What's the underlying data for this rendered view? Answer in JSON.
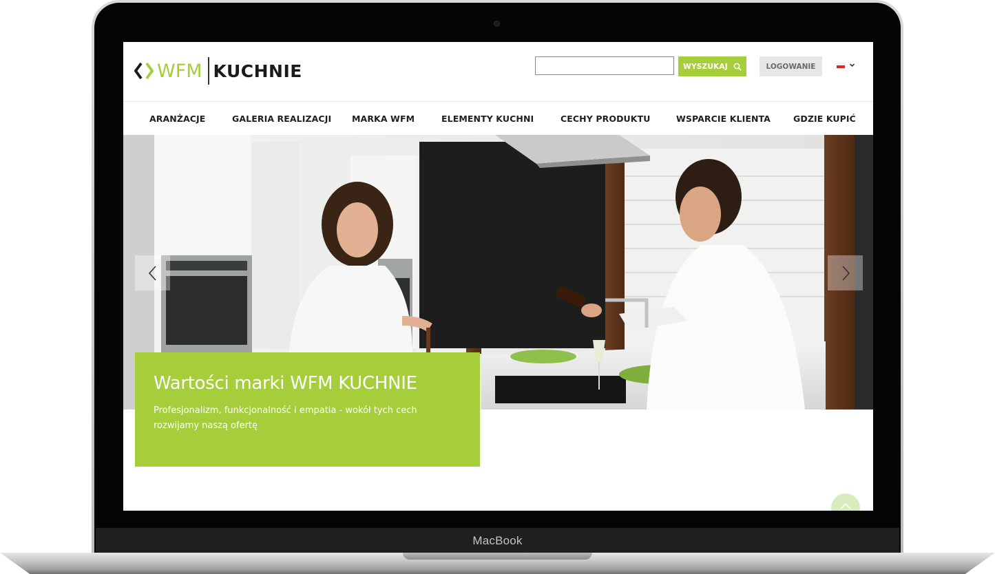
{
  "device": {
    "brand_label": "MacBook"
  },
  "header": {
    "logo": {
      "wfm": "WFM",
      "kuchnie": "KUCHNIE"
    },
    "search": {
      "value": "",
      "placeholder": "",
      "button_label": "WYSZUKAJ",
      "icon": "search-icon"
    },
    "login_label": "LOGOWANIE",
    "language": {
      "icon": "flag-pl-icon",
      "dropdown_icon": "chevron-down-icon"
    }
  },
  "nav": {
    "items": [
      {
        "label": "ARANŻACJE"
      },
      {
        "label": "GALERIA REALIZACJI"
      },
      {
        "label": "MARKA WFM"
      },
      {
        "label": "ELEMENTY KUCHNI"
      },
      {
        "label": "CECHY PRODUKTU"
      },
      {
        "label": "WSPARCIE KLIENTA"
      },
      {
        "label": "GDZIE KUPIĆ"
      }
    ]
  },
  "hero": {
    "title": "Wartości marki WFM KUCHNIE",
    "text": "Profesjonalizm, funkcjonalność i empatia - wokół tych cech rozwijamy naszą ofertę",
    "prev_icon": "chevron-left-icon",
    "next_icon": "chevron-right-icon"
  },
  "colors": {
    "brand_green": "#a6cd3a",
    "text_dark": "#1f1f1f",
    "login_bg": "#e7e7e7"
  },
  "scroll_top_icon": "chevron-up-icon"
}
